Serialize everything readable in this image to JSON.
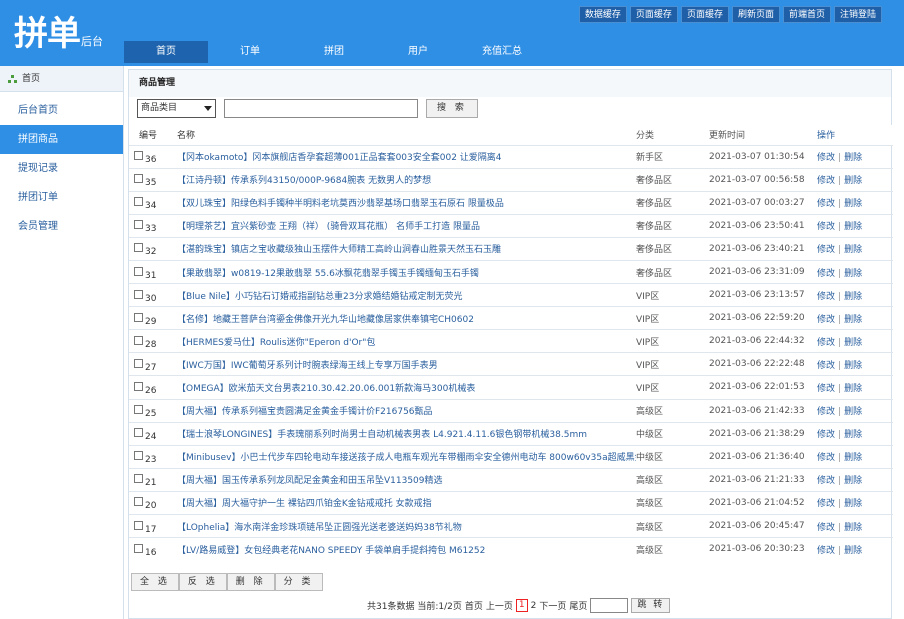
{
  "header": {
    "logo_main": "拼单",
    "logo_sub": "后台",
    "top_buttons": [
      "数据缓存",
      "页面缓存",
      "页面缓存",
      "刷新页面",
      "前端首页",
      "注销登陆"
    ],
    "nav": [
      "首页",
      "订单",
      "拼团",
      "用户",
      "充值汇总"
    ]
  },
  "sidebar": {
    "head": "首页",
    "items": [
      "后台首页",
      "拼团商品",
      "提现记录",
      "拼团订单",
      "会员管理"
    ]
  },
  "main": {
    "title": "商品管理",
    "category_select": "商品类目",
    "search_value": "",
    "search_button": "搜 索",
    "columns": [
      "编号",
      "名称",
      "分类",
      "更新时间",
      "操作"
    ],
    "op_edit": "修改",
    "op_sep": "|",
    "op_delete": "删除",
    "rows": [
      {
        "id": "36",
        "name": "【冈本okamoto】冈本旗舰店香孕套超薄001正品套套003安全套002 让爱隔离4",
        "cat": "新手区",
        "time": "2021-03-07 01:30:54"
      },
      {
        "id": "35",
        "name": "【江诗丹顿】传承系列43150/000P-9684腕表 无数男人的梦想",
        "cat": "奢侈品区",
        "time": "2021-03-07 00:56:58"
      },
      {
        "id": "34",
        "name": "【双儿珠宝】阳绿色料手镯种半明料老坑莫西沙翡翠基场口翡翠玉石原石 限量极品",
        "cat": "奢侈品区",
        "time": "2021-03-07 00:03:27"
      },
      {
        "id": "33",
        "name": "【明理茶艺】宜兴紫砂壶 王翔（祥） (骑骨双耳花瓶） 名师手工打造 限量品",
        "cat": "奢侈品区",
        "time": "2021-03-06 23:50:41"
      },
      {
        "id": "32",
        "name": "【湛韵珠宝】镇店之宝收藏级独山玉摆件大师精工高岭山涧春山胜景天然玉石玉雕",
        "cat": "奢侈品区",
        "time": "2021-03-06 23:40:21"
      },
      {
        "id": "31",
        "name": "【果敢翡翠】w0819-12果敢翡翠 55.6冰飘花翡翠手镯玉手镯缅甸玉石手镯",
        "cat": "奢侈品区",
        "time": "2021-03-06 23:31:09"
      },
      {
        "id": "30",
        "name": "【Blue Nile】小巧钻石订婚戒指副钻总重23分求婚结婚钻戒定制无荧光",
        "cat": "VIP区",
        "time": "2021-03-06 23:13:57"
      },
      {
        "id": "29",
        "name": "【名修】地藏王菩萨台湾鎏金佛像开光九华山地藏像居家供奉镇宅CH0602",
        "cat": "VIP区",
        "time": "2021-03-06 22:59:20"
      },
      {
        "id": "28",
        "name": "【HERMES爱马仕】Roulis迷你\"Eperon d'Or\"包",
        "cat": "VIP区",
        "time": "2021-03-06 22:44:32"
      },
      {
        "id": "27",
        "name": "【IWC万国】IWC葡萄牙系列计时腕表绿海王线上专享万国手表男",
        "cat": "VIP区",
        "time": "2021-03-06 22:22:48"
      },
      {
        "id": "26",
        "name": "【OMEGA】欧米茄天文台男表210.30.42.20.06.001新款海马300机械表",
        "cat": "VIP区",
        "time": "2021-03-06 22:01:53"
      },
      {
        "id": "25",
        "name": "【周大福】传承系列福宝贵圆满足金黄金手镯计价F216756甄品",
        "cat": "高级区",
        "time": "2021-03-06 21:42:33"
      },
      {
        "id": "24",
        "name": "【瑞士浪琴LONGINES】手表瑰丽系列时尚男士自动机械表男表 L4.921.4.11.6银色钢带机械38.5mm",
        "cat": "中级区",
        "time": "2021-03-06 21:38:29"
      },
      {
        "id": "23",
        "name": "【Minibusev】小巴士代步车四轮电动车接送孩子成人电瓶车观光车带棚雨伞安全德州电动车 800w60v35a超威黑金+棚",
        "cat": "中级区",
        "time": "2021-03-06 21:36:40"
      },
      {
        "id": "21",
        "name": "【周大福】国玉传承系列龙凤配足金黄金和田玉吊坠V113509精选",
        "cat": "高级区",
        "time": "2021-03-06 21:21:33"
      },
      {
        "id": "20",
        "name": "【周大福】周大福守护一生 裸钻四爪铂金K金钻戒戒托 女款戒指",
        "cat": "高级区",
        "time": "2021-03-06 21:04:52"
      },
      {
        "id": "17",
        "name": "【LOphelia】海水南洋金珍珠项链吊坠正圆强光送老婆送妈妈38节礼物",
        "cat": "高级区",
        "time": "2021-03-06 20:45:47"
      },
      {
        "id": "16",
        "name": "【LV/路易威登】女包经典老花NANO SPEEDY 手袋单肩手提斜挎包 M61252",
        "cat": "高级区",
        "time": "2021-03-06 20:30:23"
      }
    ],
    "bottom_buttons": [
      "全 选",
      "反 选",
      "删 除",
      "分 类"
    ]
  },
  "pager": {
    "summary": "共31条数据 当前:1/2页",
    "first": "首页",
    "prev": "上一页",
    "pages": [
      "1",
      "2"
    ],
    "current": "1",
    "next": "下一页",
    "last": "尾页",
    "goto_value": "",
    "goto_button": "跳 转"
  },
  "colors": {
    "header_bg": "#2f8fe5",
    "nav_active": "#1e63ad",
    "link": "#2a5f9e",
    "current_page": "#ee2222"
  }
}
